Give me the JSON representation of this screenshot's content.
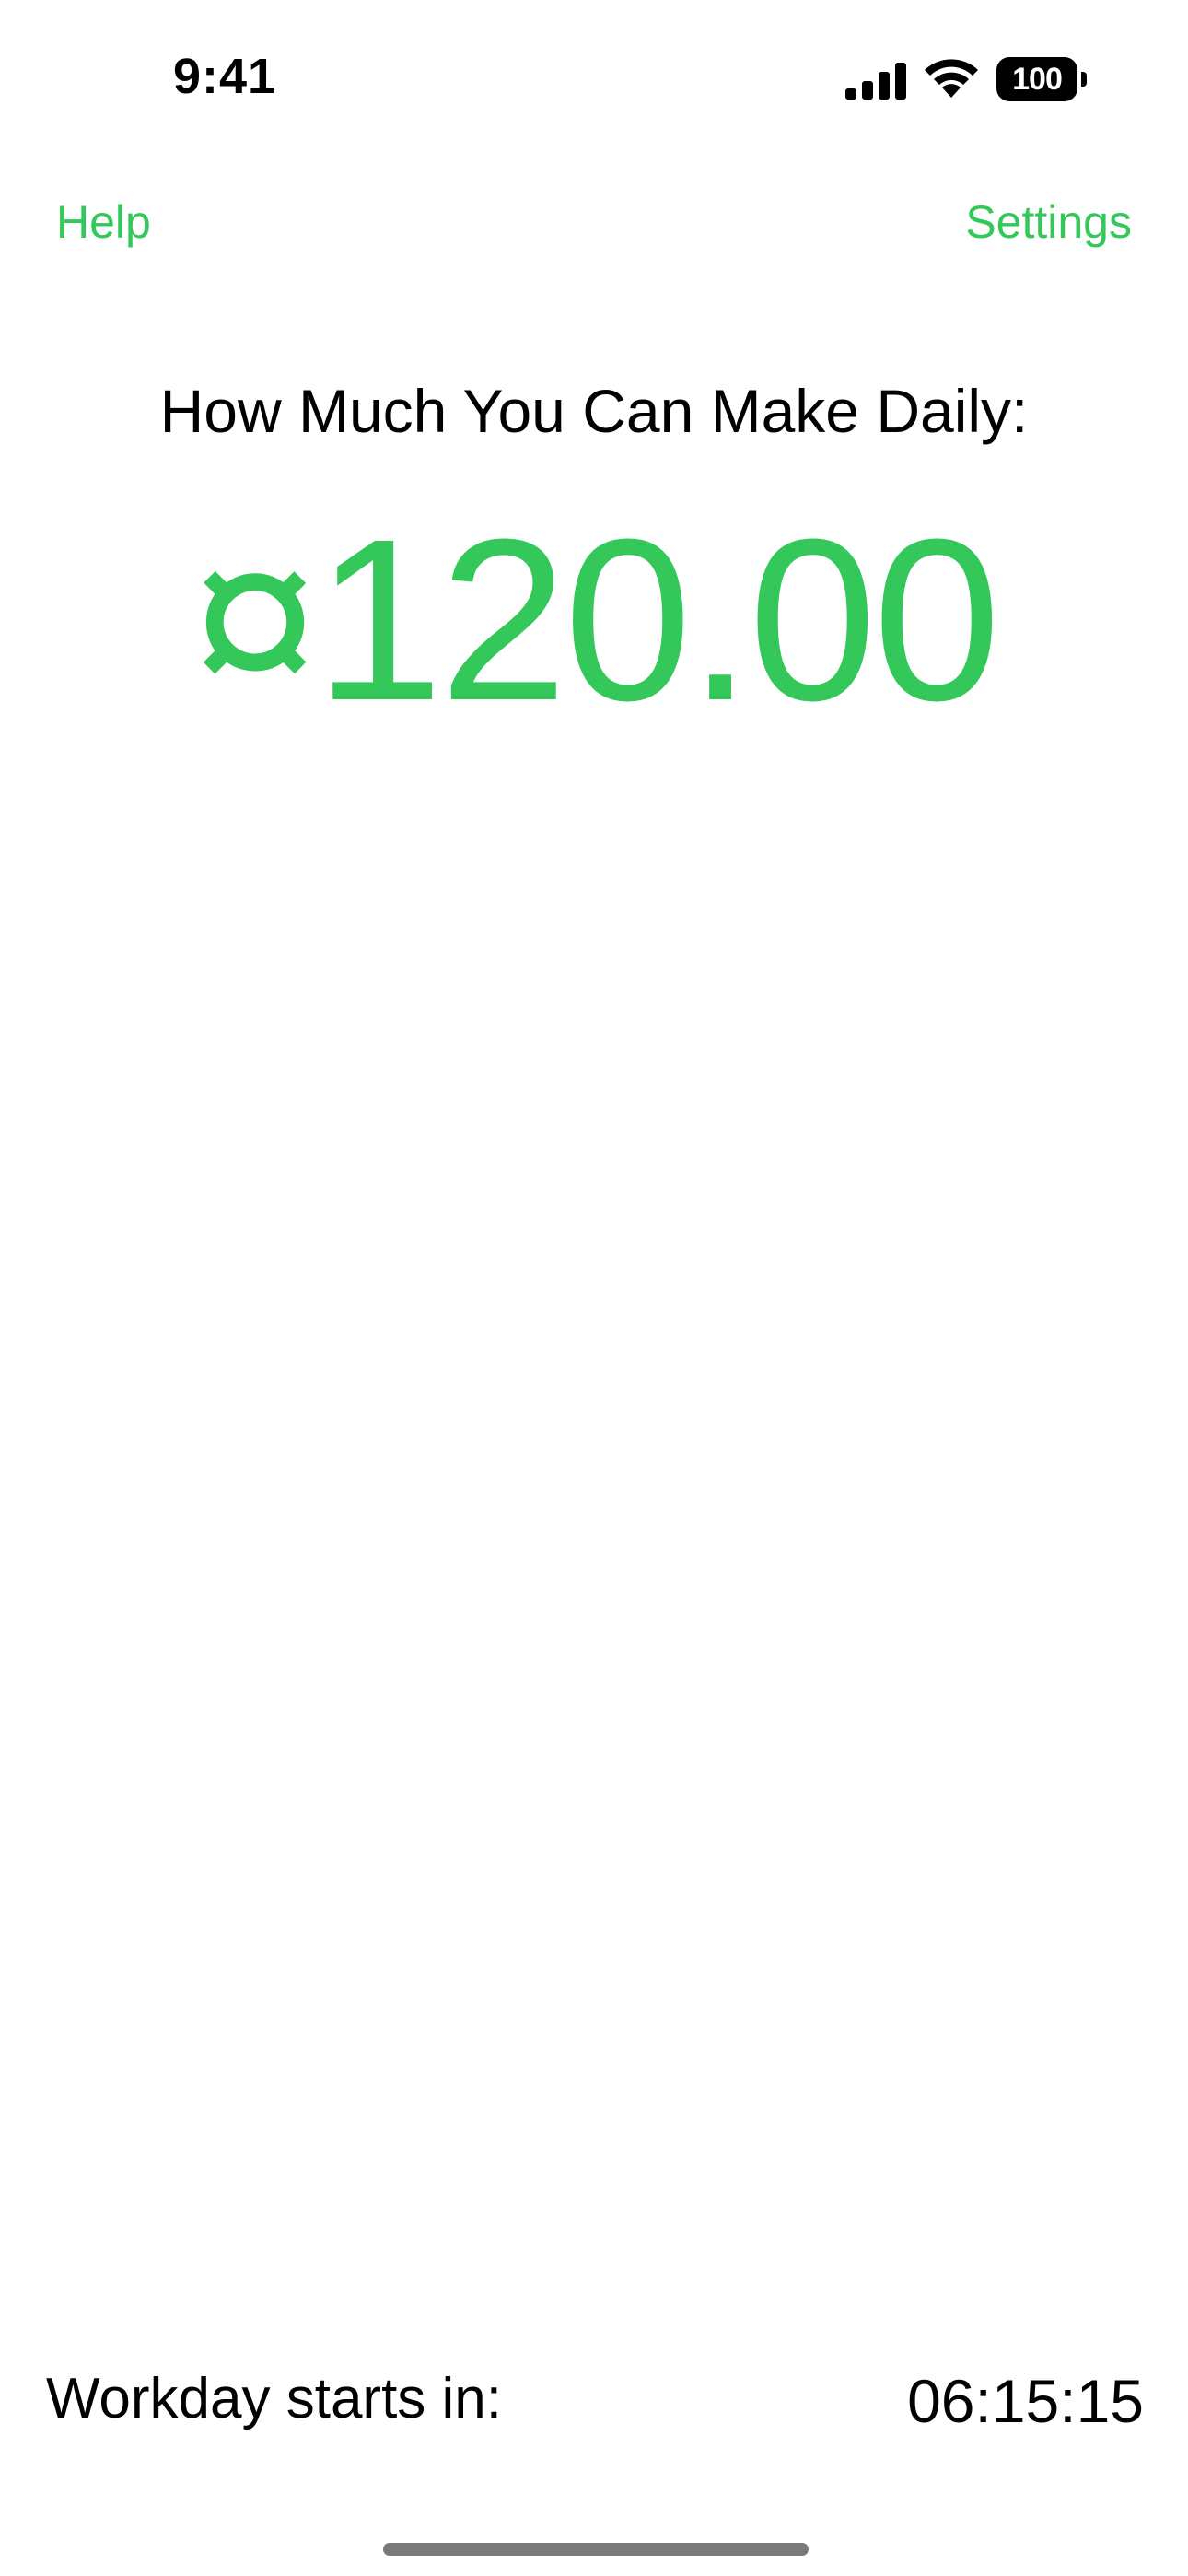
{
  "status_bar": {
    "time": "9:41",
    "battery_level": "100",
    "signal_icon": "cellular-signal-icon",
    "wifi_icon": "wifi-icon",
    "battery_icon": "battery-icon"
  },
  "nav": {
    "left_label": "Help",
    "right_label": "Settings"
  },
  "main": {
    "headline": "How Much You Can Make Daily:",
    "amount": "¤120.00"
  },
  "footer": {
    "label": "Workday starts in:",
    "countdown": "06:15:15"
  },
  "colors": {
    "accent": "#34c759",
    "text": "#000000",
    "background": "#ffffff"
  }
}
